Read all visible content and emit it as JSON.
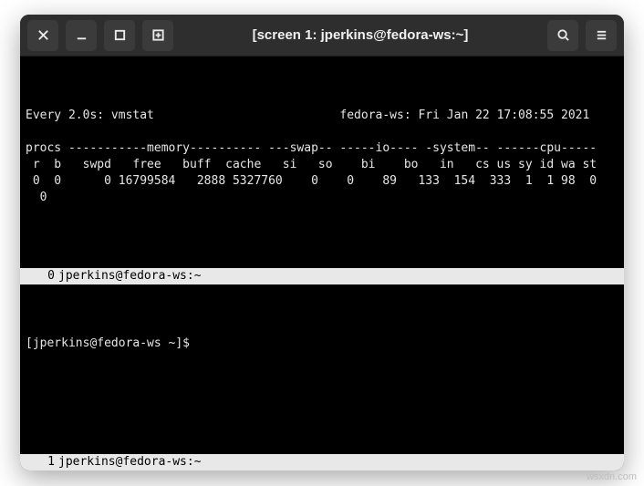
{
  "window": {
    "title": "[screen 1: jperkins@fedora-ws:~]"
  },
  "titlebar_icons": {
    "close": "close-icon",
    "minimize": "minimize-icon",
    "maximize": "maximize-icon",
    "new_tab": "new-tab-icon",
    "search": "search-icon",
    "menu": "hamburger-icon"
  },
  "watch": {
    "header_left": "Every 2.0s: vmstat",
    "header_right": "fedora-ws: Fri Jan 22 17:08:55 2021",
    "table": {
      "group_header": "procs -----------memory---------- ---swap-- -----io---- -system-- ------cpu-----",
      "col_header": " r  b   swpd   free   buff  cache   si   so    bi    bo   in   cs us sy id wa st",
      "row1": " 0  0      0 16799584   2888 5327760    0    0    89   133  154  333  1  1 98  0",
      "row1_wrap": "  0"
    }
  },
  "panes": [
    {
      "index": 0,
      "status_label": "jperkins@fedora-ws:~"
    },
    {
      "index": 1,
      "status_label": "jperkins@fedora-ws:~"
    }
  ],
  "prompt": {
    "text": "[jperkins@fedora-ws ~]$"
  },
  "watermark": "wsxdn.com"
}
